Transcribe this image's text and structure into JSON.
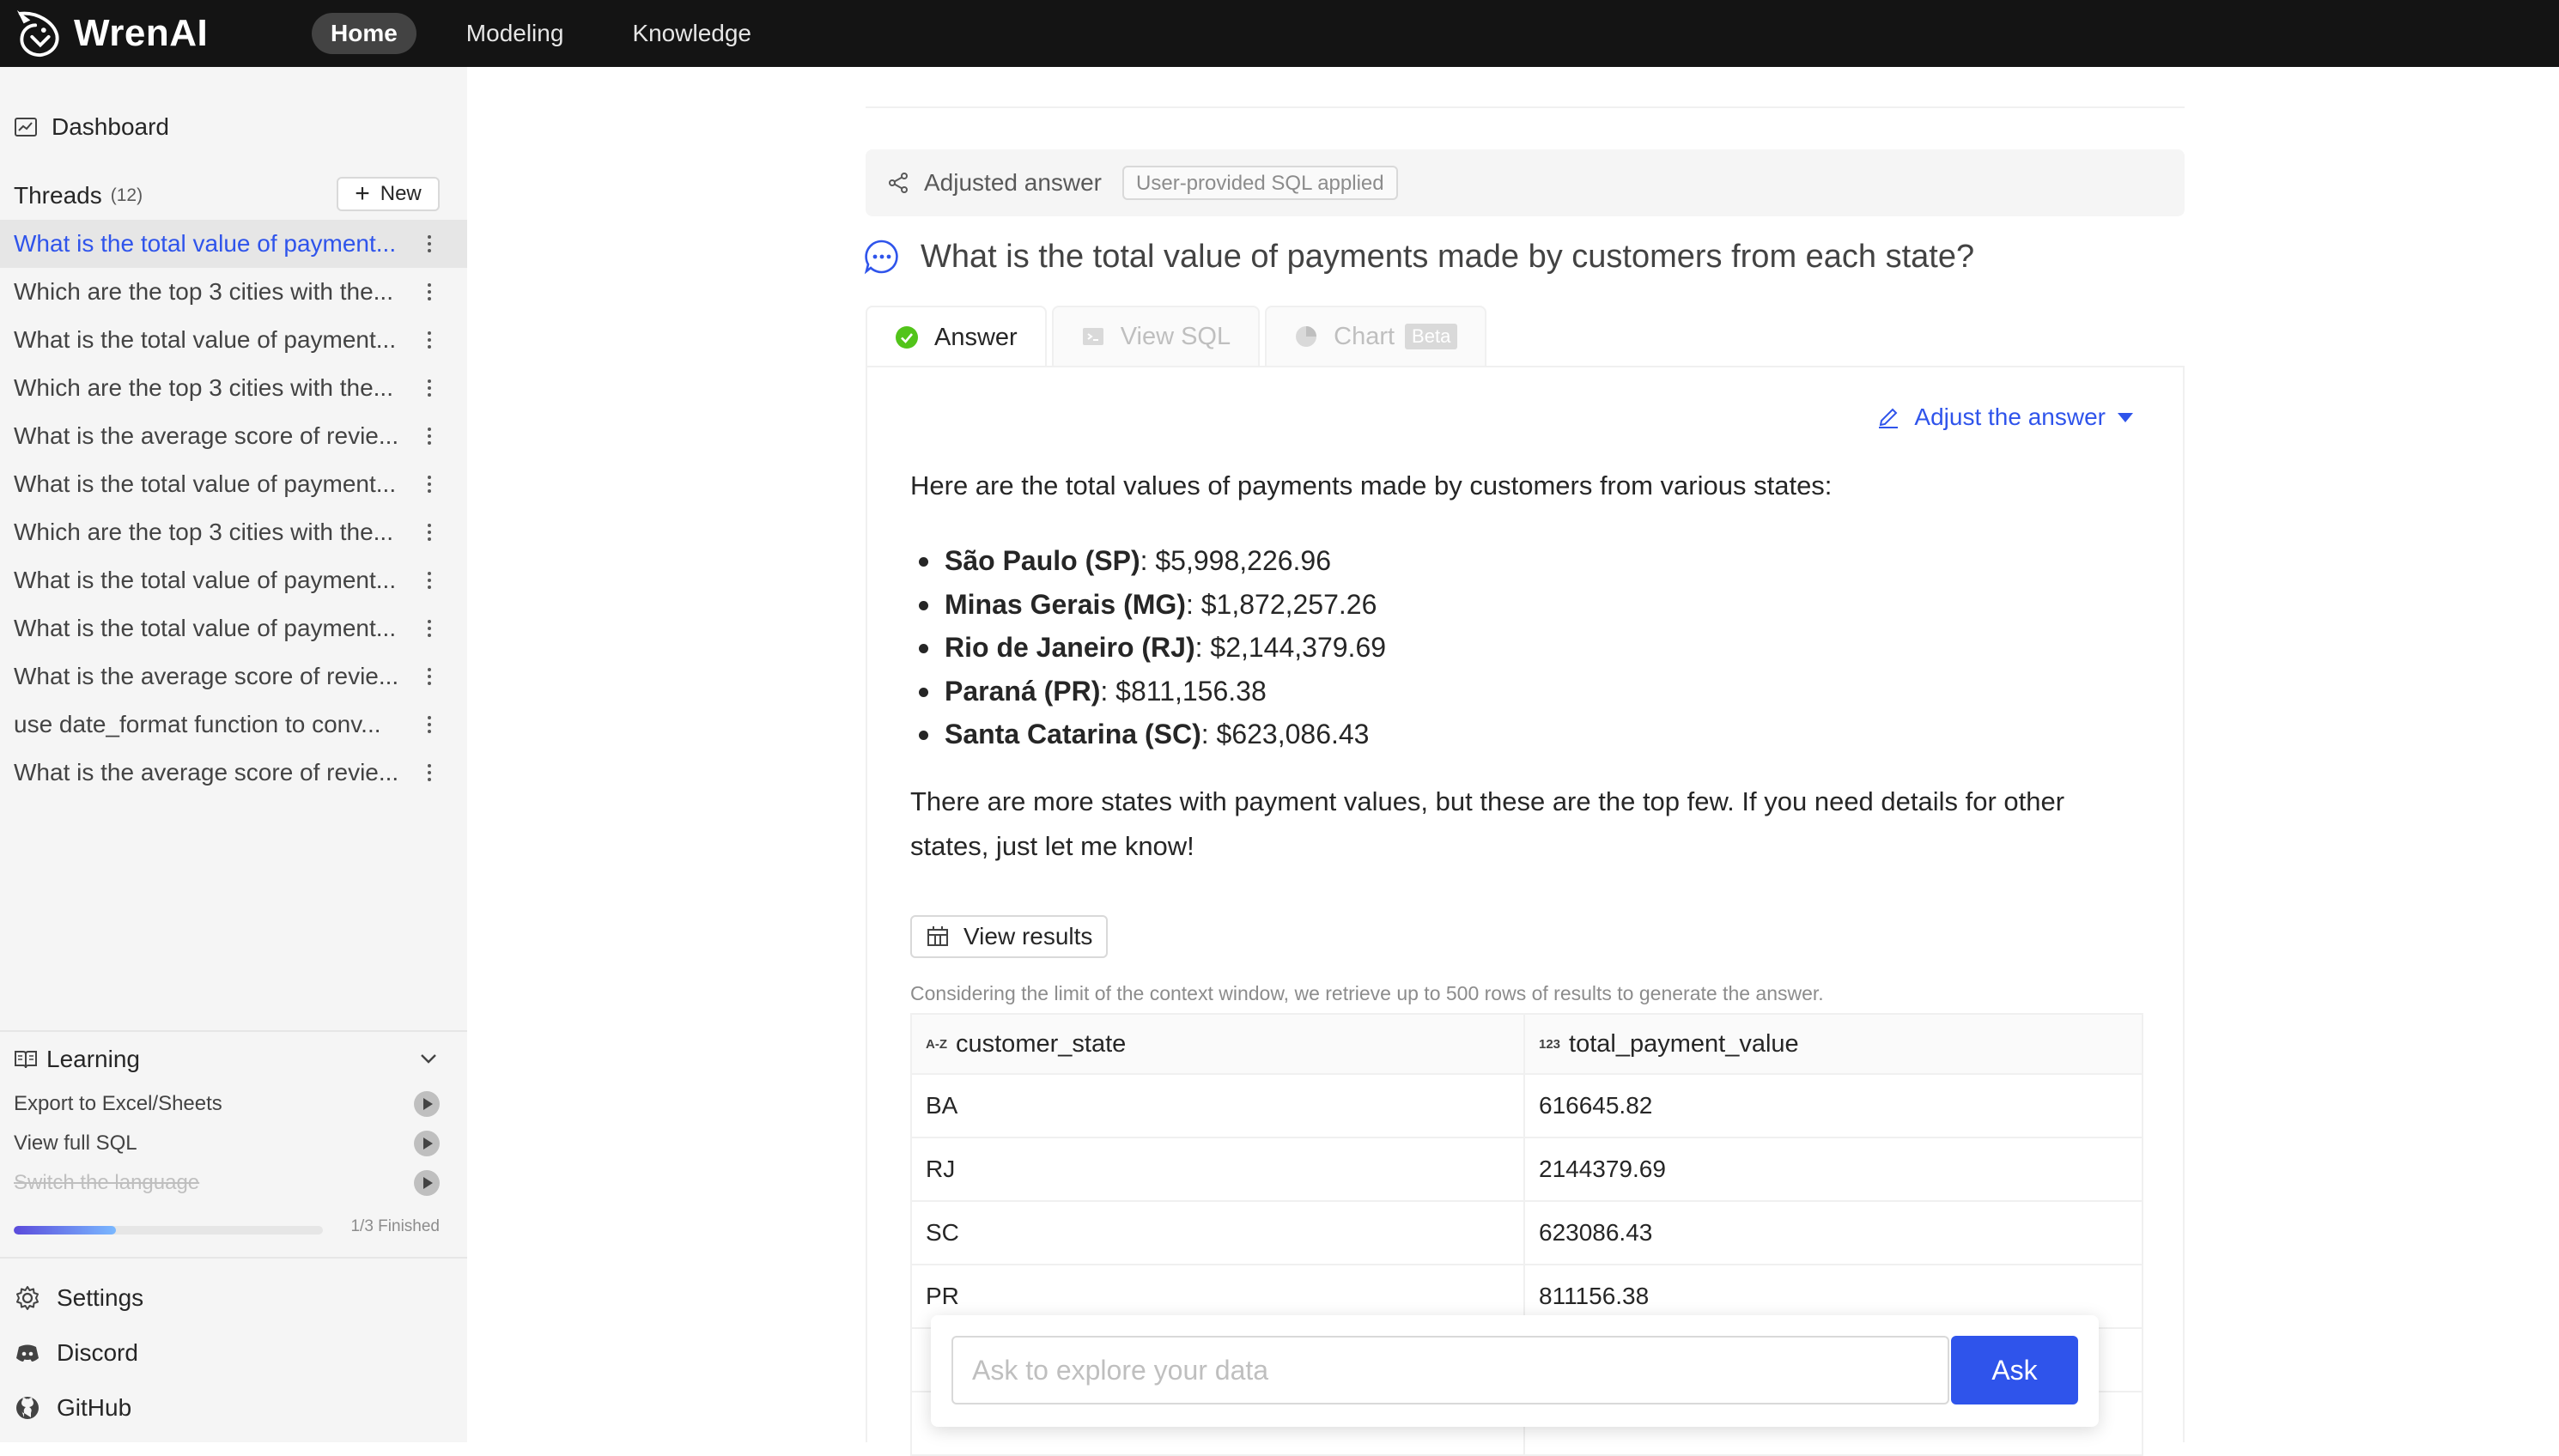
{
  "app": {
    "name": "WrenAI"
  },
  "nav": {
    "items": [
      "Home",
      "Modeling",
      "Knowledge"
    ],
    "active": "Home"
  },
  "sidebar": {
    "dashboard": "Dashboard",
    "threads_title": "Threads",
    "threads_count": "(12)",
    "new_button": "New",
    "threads": [
      "What is the total value of payment...",
      "Which are the top 3 cities with the...",
      "What is the total value of payment...",
      "Which are the top 3 cities with the...",
      "What is the average score of revie...",
      "What is the total value of payment...",
      "Which are the top 3 cities with the...",
      "What is the total value of payment...",
      "What is the total value of payment...",
      "What is the average score of revie...",
      "use date_format function to conv...",
      "What is the average score of revie..."
    ],
    "learning": {
      "title": "Learning",
      "items": [
        {
          "label": "Export to Excel/Sheets",
          "done": false
        },
        {
          "label": "View full SQL",
          "done": false
        },
        {
          "label": "Switch the language",
          "done": true
        }
      ],
      "progress": 0.33,
      "progress_text": "1/3 Finished"
    },
    "links": [
      "Settings",
      "Discord",
      "GitHub"
    ]
  },
  "main": {
    "adjusted_label": "Adjusted answer",
    "sql_tag": "User-provided SQL applied",
    "question": "What is the total value of payments made by customers from each state?",
    "tabs": {
      "answer": "Answer",
      "view_sql": "View SQL",
      "chart": "Chart",
      "beta": "Beta"
    },
    "adjust_button": "Adjust the answer",
    "answer_intro": "Here are the total values of payments made by customers from various states:",
    "states": [
      {
        "name": "São Paulo (SP)",
        "value": ": $5,998,226.96"
      },
      {
        "name": "Minas Gerais (MG)",
        "value": ": $1,872,257.26"
      },
      {
        "name": "Rio de Janeiro (RJ)",
        "value": ": $2,144,379.69"
      },
      {
        "name": "Paraná (PR)",
        "value": ": $811,156.38"
      },
      {
        "name": "Santa Catarina (SC)",
        "value": ": $623,086.43"
      }
    ],
    "answer_outro": "There are more states with payment values, but these are the top few. If you need details for other states, just let me know!",
    "view_results": "View results",
    "context_note": "Considering the limit of the context window, we retrieve up to 500 rows of results to generate the answer.",
    "table": {
      "columns": [
        {
          "type": "A-Z",
          "name": "customer_state"
        },
        {
          "type": "123",
          "name": "total_payment_value"
        }
      ],
      "rows": [
        [
          "BA",
          "616645.82"
        ],
        [
          "RJ",
          "2144379.69"
        ],
        [
          "SC",
          "623086.43"
        ],
        [
          "PR",
          "811156.38"
        ]
      ]
    },
    "ask": {
      "placeholder": "Ask to explore your data",
      "button": "Ask"
    }
  }
}
